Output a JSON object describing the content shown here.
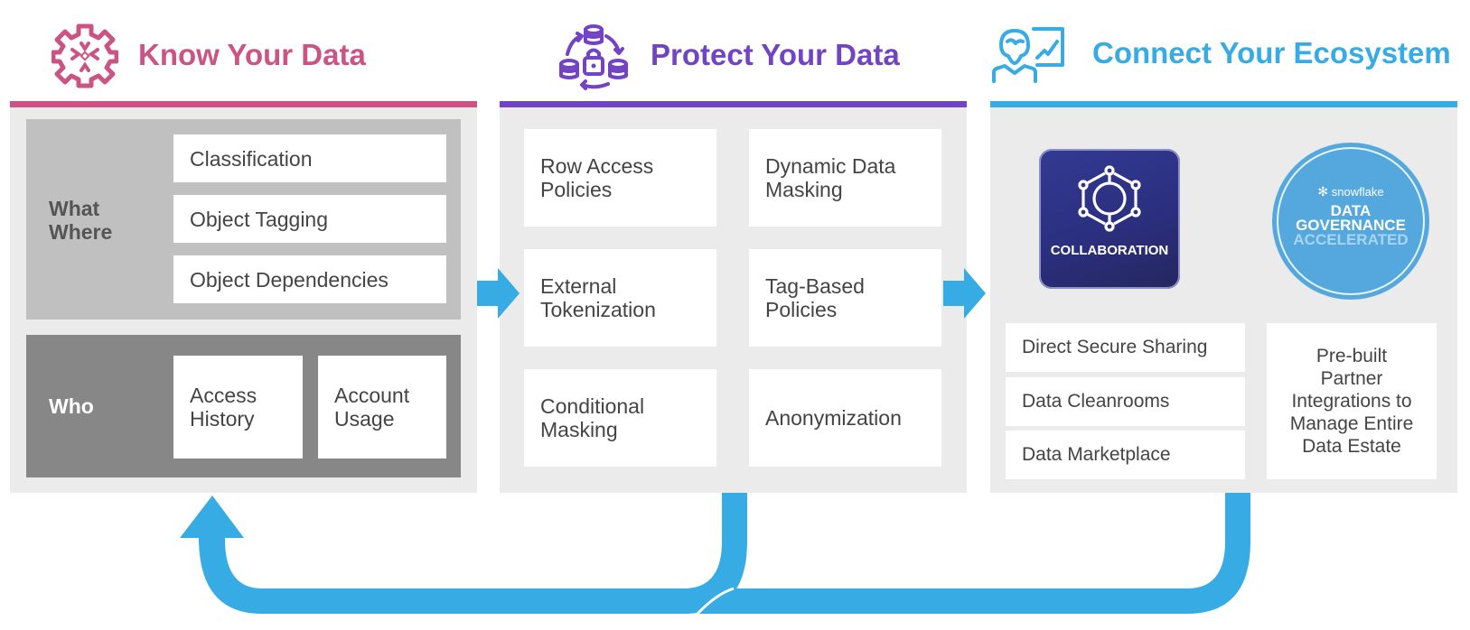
{
  "colors": {
    "know": "#cc5484",
    "protect": "#7343c6",
    "connect": "#37abe3",
    "panel_bg": "#ebebeb",
    "what_where_bg": "#c0c0c0",
    "who_bg": "#878787",
    "collab_badge": "#2b2f7f",
    "governance_badge": "#55a8de",
    "flow_arrow": "#37abe3"
  },
  "sections": {
    "know": {
      "title": "Know Your Data",
      "icon": "gear-snowflake-icon",
      "what_where": {
        "label_line1": "What",
        "label_line2": "Where",
        "items": [
          "Classification",
          "Object Tagging",
          "Object Dependencies"
        ]
      },
      "who": {
        "label": "Who",
        "items": [
          {
            "line1": "Access",
            "line2": "History"
          },
          {
            "line1": "Account",
            "line2": "Usage"
          }
        ]
      }
    },
    "protect": {
      "title": "Protect Your Data",
      "icon": "database-lock-cycle-icon",
      "items": [
        {
          "line1": "Row Access",
          "line2": "Policies"
        },
        {
          "line1": "Dynamic Data",
          "line2": "Masking"
        },
        {
          "line1": "External",
          "line2": "Tokenization"
        },
        {
          "line1": "Tag-Based",
          "line2": "Policies"
        },
        {
          "line1": "Conditional",
          "line2": "Masking"
        },
        {
          "line1": "Anonymization",
          "line2": ""
        }
      ]
    },
    "connect": {
      "title": "Connect Your Ecosystem",
      "icon": "person-chart-icon",
      "collaboration_badge": "COLLABORATION",
      "governance_badge": {
        "brand": "snowflake",
        "line1": "DATA",
        "line2": "GOVERNANCE",
        "line3": "ACCELERATED"
      },
      "sharing_items": [
        "Direct Secure Sharing",
        "Data Cleanrooms",
        "Data Marketplace"
      ],
      "partner_text": [
        "Pre-built",
        "Partner",
        "Integrations to",
        "Manage Entire",
        "Data Estate"
      ]
    }
  }
}
